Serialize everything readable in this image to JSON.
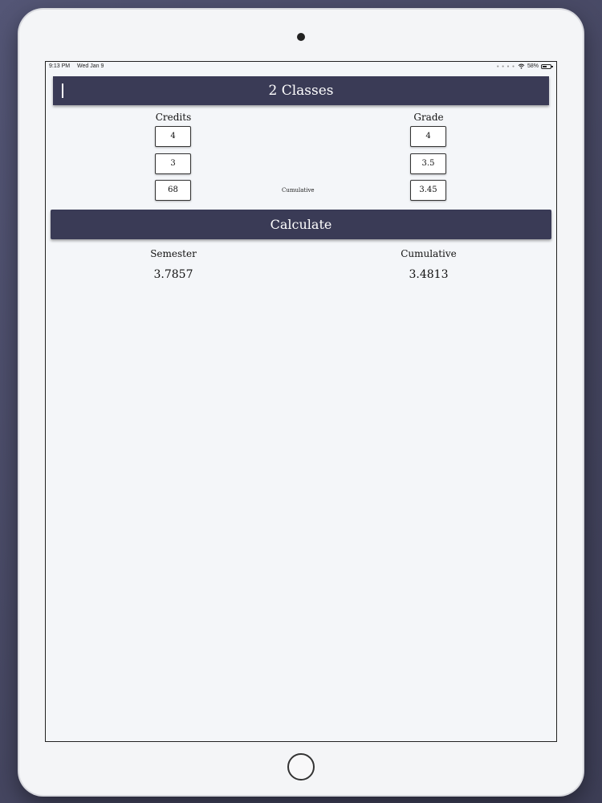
{
  "status_bar": {
    "time": "9:13 PM",
    "date": "Wed Jan 9",
    "battery": "58%",
    "battery_level": 0.58
  },
  "header": {
    "title": "2 Classes"
  },
  "columns": {
    "credits_label": "Credits",
    "grade_label": "Grade"
  },
  "rows": [
    {
      "credits": "4",
      "grade": "4"
    },
    {
      "credits": "3",
      "grade": "3.5"
    },
    {
      "credits": "68",
      "grade": "3.45",
      "middle_label": "Cumulative"
    }
  ],
  "calculate_label": "Calculate",
  "results": {
    "semester_label": "Semester",
    "semester_value": "3.7857",
    "cumulative_label": "Cumulative",
    "cumulative_value": "3.4813"
  },
  "colors": {
    "accent": "#3a3b56",
    "background": "#f4f6f9"
  }
}
